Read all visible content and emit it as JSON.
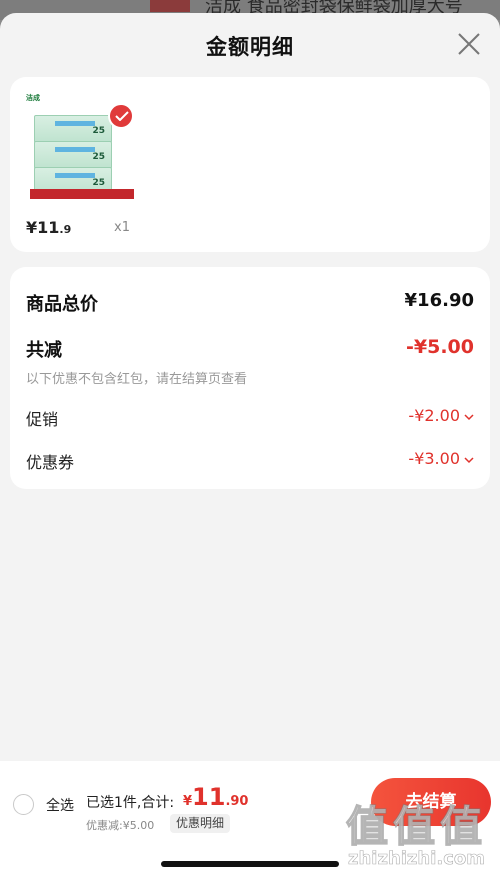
{
  "background": {
    "title": "洁成 食品密封袋保鲜袋加厚大号"
  },
  "sheet": {
    "title": "金额明细",
    "close_icon": "close-icon"
  },
  "product": {
    "brand": "洁成",
    "box_number": "25",
    "price_main": "¥11",
    "price_decimal": ".9",
    "quantity": "x1"
  },
  "summary": {
    "total_label": "商品总价",
    "total_value": "¥16.90",
    "reduce_label": "共减",
    "reduce_value": "-¥5.00",
    "reduce_note": "以下优惠不包含红包，请在结算页查看",
    "promo_label": "促销",
    "promo_value": "-¥2.00",
    "coupon_label": "优惠券",
    "coupon_value": "-¥3.00"
  },
  "bottom_bar": {
    "select_all": "全选",
    "selected_text": "已选1件,合计:",
    "total_currency": "¥",
    "total_integer": "11",
    "total_decimal": ".90",
    "discount_text": "优惠减:¥5.00",
    "detail_chip": "优惠明细",
    "checkout_label": "去结算"
  },
  "watermark": {
    "glyphs": "值值值",
    "url": "zhizhizhi.com"
  },
  "colors": {
    "accent": "#e0322c",
    "sheet_bg": "#f3f3f3",
    "card_bg": "#ffffff"
  }
}
